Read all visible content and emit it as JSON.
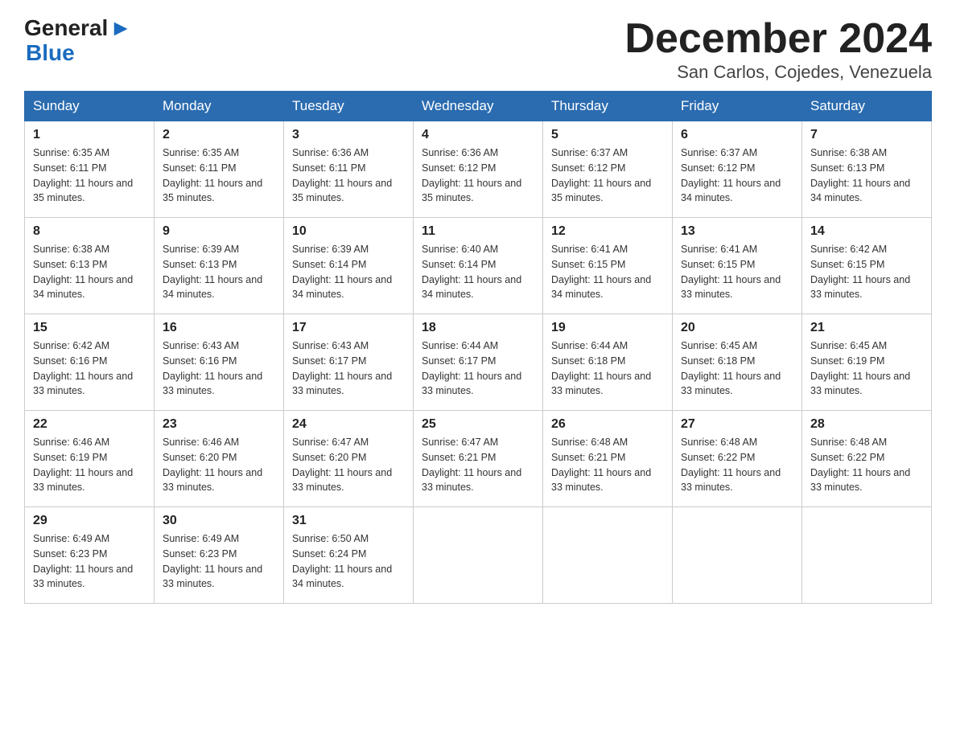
{
  "header": {
    "logo_general": "General",
    "logo_blue": "Blue",
    "month_title": "December 2024",
    "subtitle": "San Carlos, Cojedes, Venezuela"
  },
  "weekdays": [
    "Sunday",
    "Monday",
    "Tuesday",
    "Wednesday",
    "Thursday",
    "Friday",
    "Saturday"
  ],
  "weeks": [
    [
      {
        "day": "1",
        "sunrise": "6:35 AM",
        "sunset": "6:11 PM",
        "daylight": "11 hours and 35 minutes."
      },
      {
        "day": "2",
        "sunrise": "6:35 AM",
        "sunset": "6:11 PM",
        "daylight": "11 hours and 35 minutes."
      },
      {
        "day": "3",
        "sunrise": "6:36 AM",
        "sunset": "6:11 PM",
        "daylight": "11 hours and 35 minutes."
      },
      {
        "day": "4",
        "sunrise": "6:36 AM",
        "sunset": "6:12 PM",
        "daylight": "11 hours and 35 minutes."
      },
      {
        "day": "5",
        "sunrise": "6:37 AM",
        "sunset": "6:12 PM",
        "daylight": "11 hours and 35 minutes."
      },
      {
        "day": "6",
        "sunrise": "6:37 AM",
        "sunset": "6:12 PM",
        "daylight": "11 hours and 34 minutes."
      },
      {
        "day": "7",
        "sunrise": "6:38 AM",
        "sunset": "6:13 PM",
        "daylight": "11 hours and 34 minutes."
      }
    ],
    [
      {
        "day": "8",
        "sunrise": "6:38 AM",
        "sunset": "6:13 PM",
        "daylight": "11 hours and 34 minutes."
      },
      {
        "day": "9",
        "sunrise": "6:39 AM",
        "sunset": "6:13 PM",
        "daylight": "11 hours and 34 minutes."
      },
      {
        "day": "10",
        "sunrise": "6:39 AM",
        "sunset": "6:14 PM",
        "daylight": "11 hours and 34 minutes."
      },
      {
        "day": "11",
        "sunrise": "6:40 AM",
        "sunset": "6:14 PM",
        "daylight": "11 hours and 34 minutes."
      },
      {
        "day": "12",
        "sunrise": "6:41 AM",
        "sunset": "6:15 PM",
        "daylight": "11 hours and 34 minutes."
      },
      {
        "day": "13",
        "sunrise": "6:41 AM",
        "sunset": "6:15 PM",
        "daylight": "11 hours and 33 minutes."
      },
      {
        "day": "14",
        "sunrise": "6:42 AM",
        "sunset": "6:15 PM",
        "daylight": "11 hours and 33 minutes."
      }
    ],
    [
      {
        "day": "15",
        "sunrise": "6:42 AM",
        "sunset": "6:16 PM",
        "daylight": "11 hours and 33 minutes."
      },
      {
        "day": "16",
        "sunrise": "6:43 AM",
        "sunset": "6:16 PM",
        "daylight": "11 hours and 33 minutes."
      },
      {
        "day": "17",
        "sunrise": "6:43 AM",
        "sunset": "6:17 PM",
        "daylight": "11 hours and 33 minutes."
      },
      {
        "day": "18",
        "sunrise": "6:44 AM",
        "sunset": "6:17 PM",
        "daylight": "11 hours and 33 minutes."
      },
      {
        "day": "19",
        "sunrise": "6:44 AM",
        "sunset": "6:18 PM",
        "daylight": "11 hours and 33 minutes."
      },
      {
        "day": "20",
        "sunrise": "6:45 AM",
        "sunset": "6:18 PM",
        "daylight": "11 hours and 33 minutes."
      },
      {
        "day": "21",
        "sunrise": "6:45 AM",
        "sunset": "6:19 PM",
        "daylight": "11 hours and 33 minutes."
      }
    ],
    [
      {
        "day": "22",
        "sunrise": "6:46 AM",
        "sunset": "6:19 PM",
        "daylight": "11 hours and 33 minutes."
      },
      {
        "day": "23",
        "sunrise": "6:46 AM",
        "sunset": "6:20 PM",
        "daylight": "11 hours and 33 minutes."
      },
      {
        "day": "24",
        "sunrise": "6:47 AM",
        "sunset": "6:20 PM",
        "daylight": "11 hours and 33 minutes."
      },
      {
        "day": "25",
        "sunrise": "6:47 AM",
        "sunset": "6:21 PM",
        "daylight": "11 hours and 33 minutes."
      },
      {
        "day": "26",
        "sunrise": "6:48 AM",
        "sunset": "6:21 PM",
        "daylight": "11 hours and 33 minutes."
      },
      {
        "day": "27",
        "sunrise": "6:48 AM",
        "sunset": "6:22 PM",
        "daylight": "11 hours and 33 minutes."
      },
      {
        "day": "28",
        "sunrise": "6:48 AM",
        "sunset": "6:22 PM",
        "daylight": "11 hours and 33 minutes."
      }
    ],
    [
      {
        "day": "29",
        "sunrise": "6:49 AM",
        "sunset": "6:23 PM",
        "daylight": "11 hours and 33 minutes."
      },
      {
        "day": "30",
        "sunrise": "6:49 AM",
        "sunset": "6:23 PM",
        "daylight": "11 hours and 33 minutes."
      },
      {
        "day": "31",
        "sunrise": "6:50 AM",
        "sunset": "6:24 PM",
        "daylight": "11 hours and 34 minutes."
      },
      null,
      null,
      null,
      null
    ]
  ],
  "labels": {
    "sunrise": "Sunrise:",
    "sunset": "Sunset:",
    "daylight": "Daylight:"
  }
}
